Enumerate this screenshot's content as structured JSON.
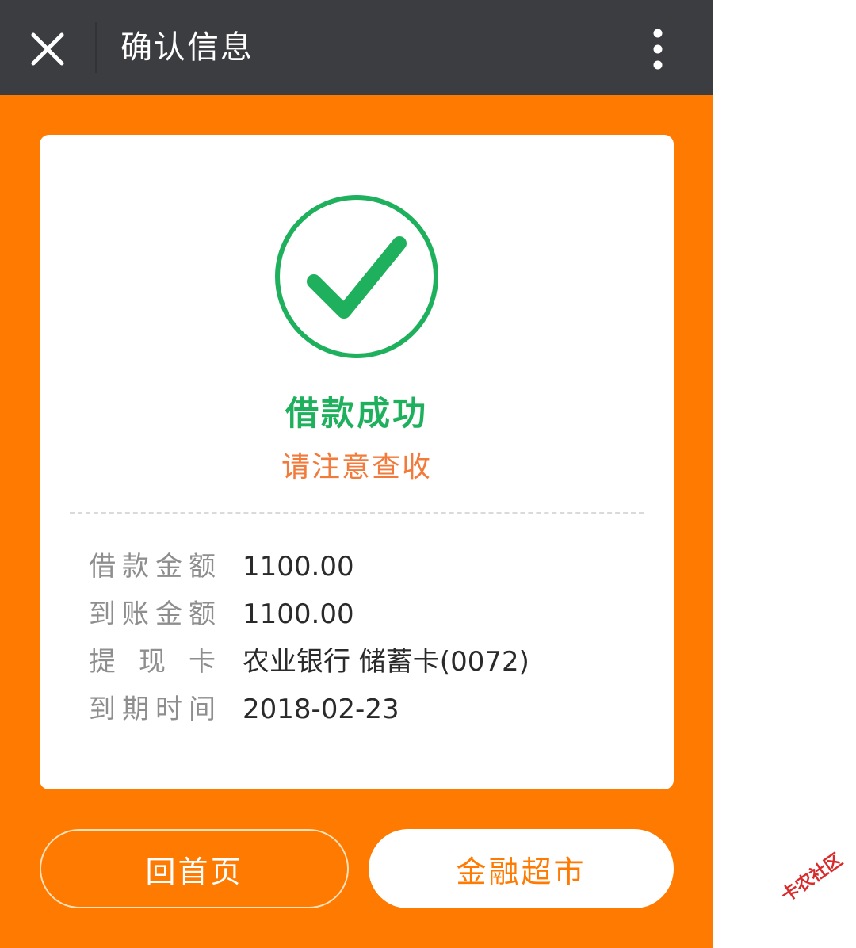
{
  "titlebar": {
    "title": "确认信息",
    "close_icon": "close-icon",
    "more_icon": "more-vertical-icon"
  },
  "status": {
    "icon": "check-circle-icon",
    "title": "借款成功",
    "subtitle": "请注意查收"
  },
  "details": [
    {
      "label": "借款金额",
      "value": "1100.00"
    },
    {
      "label": "到账金额",
      "value": "1100.00"
    },
    {
      "label": "提现卡",
      "value": "农业银行 储蓄卡(0072)"
    },
    {
      "label": "到期时间",
      "value": "2018-02-23"
    }
  ],
  "buttons": {
    "home": "回首页",
    "market": "金融超市"
  },
  "watermark": "卡农社区",
  "colors": {
    "titlebar": "#3C3D41",
    "background": "#FF7A00",
    "success": "#1EB05C",
    "subtitle": "#F27A3A"
  }
}
